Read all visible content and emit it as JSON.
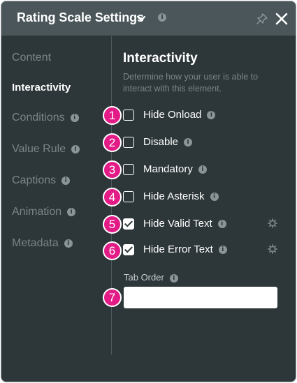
{
  "header": {
    "title": "Rating Scale Settings",
    "info_glyph": "i",
    "icons": [
      "chevron-down-icon",
      "info-icon",
      "pin-icon",
      "close-icon"
    ]
  },
  "sidebar": {
    "items": [
      {
        "label": "Content",
        "info": false
      },
      {
        "label": "Interactivity",
        "info": false,
        "active": true
      },
      {
        "label": "Conditions",
        "info": true
      },
      {
        "label": "Value Rule",
        "info": true
      },
      {
        "label": "Captions",
        "info": true
      },
      {
        "label": "Animation",
        "info": true
      },
      {
        "label": "Metadata",
        "info": true
      }
    ]
  },
  "main": {
    "title": "Interactivity",
    "description": "Determine how your user is able to interact with this element.",
    "options": [
      {
        "label": "Hide Onload",
        "checked": false,
        "badge": "1"
      },
      {
        "label": "Disable",
        "checked": false,
        "badge": "2"
      },
      {
        "label": "Mandatory",
        "checked": false,
        "badge": "3"
      },
      {
        "label": "Hide Asterisk",
        "checked": false,
        "badge": "4"
      },
      {
        "label": "Hide Valid Text",
        "checked": true,
        "badge": "5",
        "gear": true
      },
      {
        "label": "Hide Error Text",
        "checked": true,
        "badge": "6",
        "gear": true
      }
    ],
    "tab_order": {
      "label": "Tab Order",
      "value": "",
      "badge": "7"
    }
  },
  "colors": {
    "panel_bg": "#2d3639",
    "header_bg": "#4a565a",
    "badge": "#e21b86",
    "muted_text": "#7b8588"
  }
}
